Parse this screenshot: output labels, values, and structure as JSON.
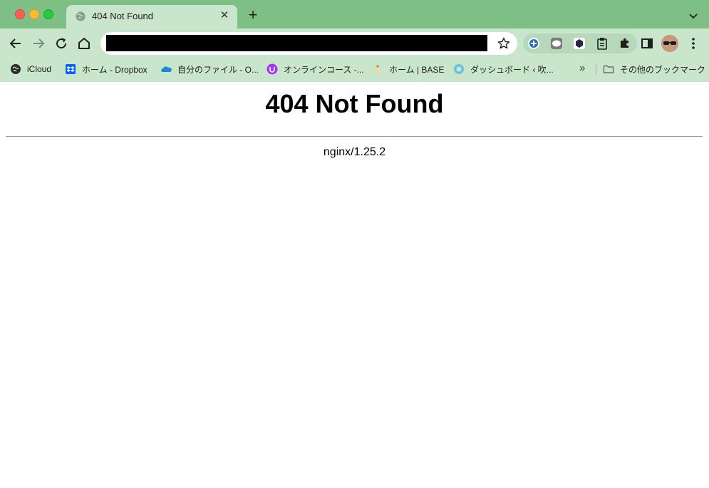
{
  "browser": {
    "tab": {
      "title": "404 Not Found"
    },
    "bookmarks": [
      {
        "label": "iCloud",
        "icon": "icloud-icon"
      },
      {
        "label": "ホーム - Dropbox",
        "icon": "dropbox-icon"
      },
      {
        "label": "自分のファイル - O...",
        "icon": "onedrive-icon"
      },
      {
        "label": "オンラインコース -...",
        "icon": "udemy-icon"
      },
      {
        "label": "ホーム | BASE",
        "icon": "base-icon"
      },
      {
        "label": "ダッシュボード ‹ 吹...",
        "icon": "wordpress-icon"
      }
    ],
    "bookmarks_other": "その他のブックマーク",
    "colors": {
      "titlebar": "#7dbf84",
      "toolbar": "#c9e6cc"
    }
  },
  "page": {
    "heading": "404 Not Found",
    "server": "nginx/1.25.2"
  }
}
